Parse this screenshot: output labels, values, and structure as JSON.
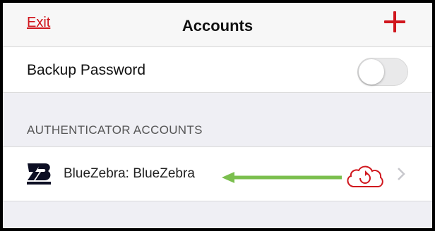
{
  "header": {
    "exit_label": "Exit",
    "title": "Accounts",
    "add_icon": "plus-icon"
  },
  "backup": {
    "label": "Backup Password",
    "toggle_on": false
  },
  "section": {
    "title": "AUTHENTICATOR ACCOUNTS"
  },
  "accounts": [
    {
      "name": "BlueZebra: BlueZebra",
      "logo_icon": "bluezebra-logo",
      "sync_icon": "cloud-sync-icon",
      "disclosure_icon": "chevron-right-icon"
    }
  ],
  "colors": {
    "accent": "#d0161d",
    "annotation_arrow": "#7bbf4e",
    "toggle_off": "#e9e9ea",
    "chevron": "#c7c7cc",
    "background": "#efeff4"
  }
}
